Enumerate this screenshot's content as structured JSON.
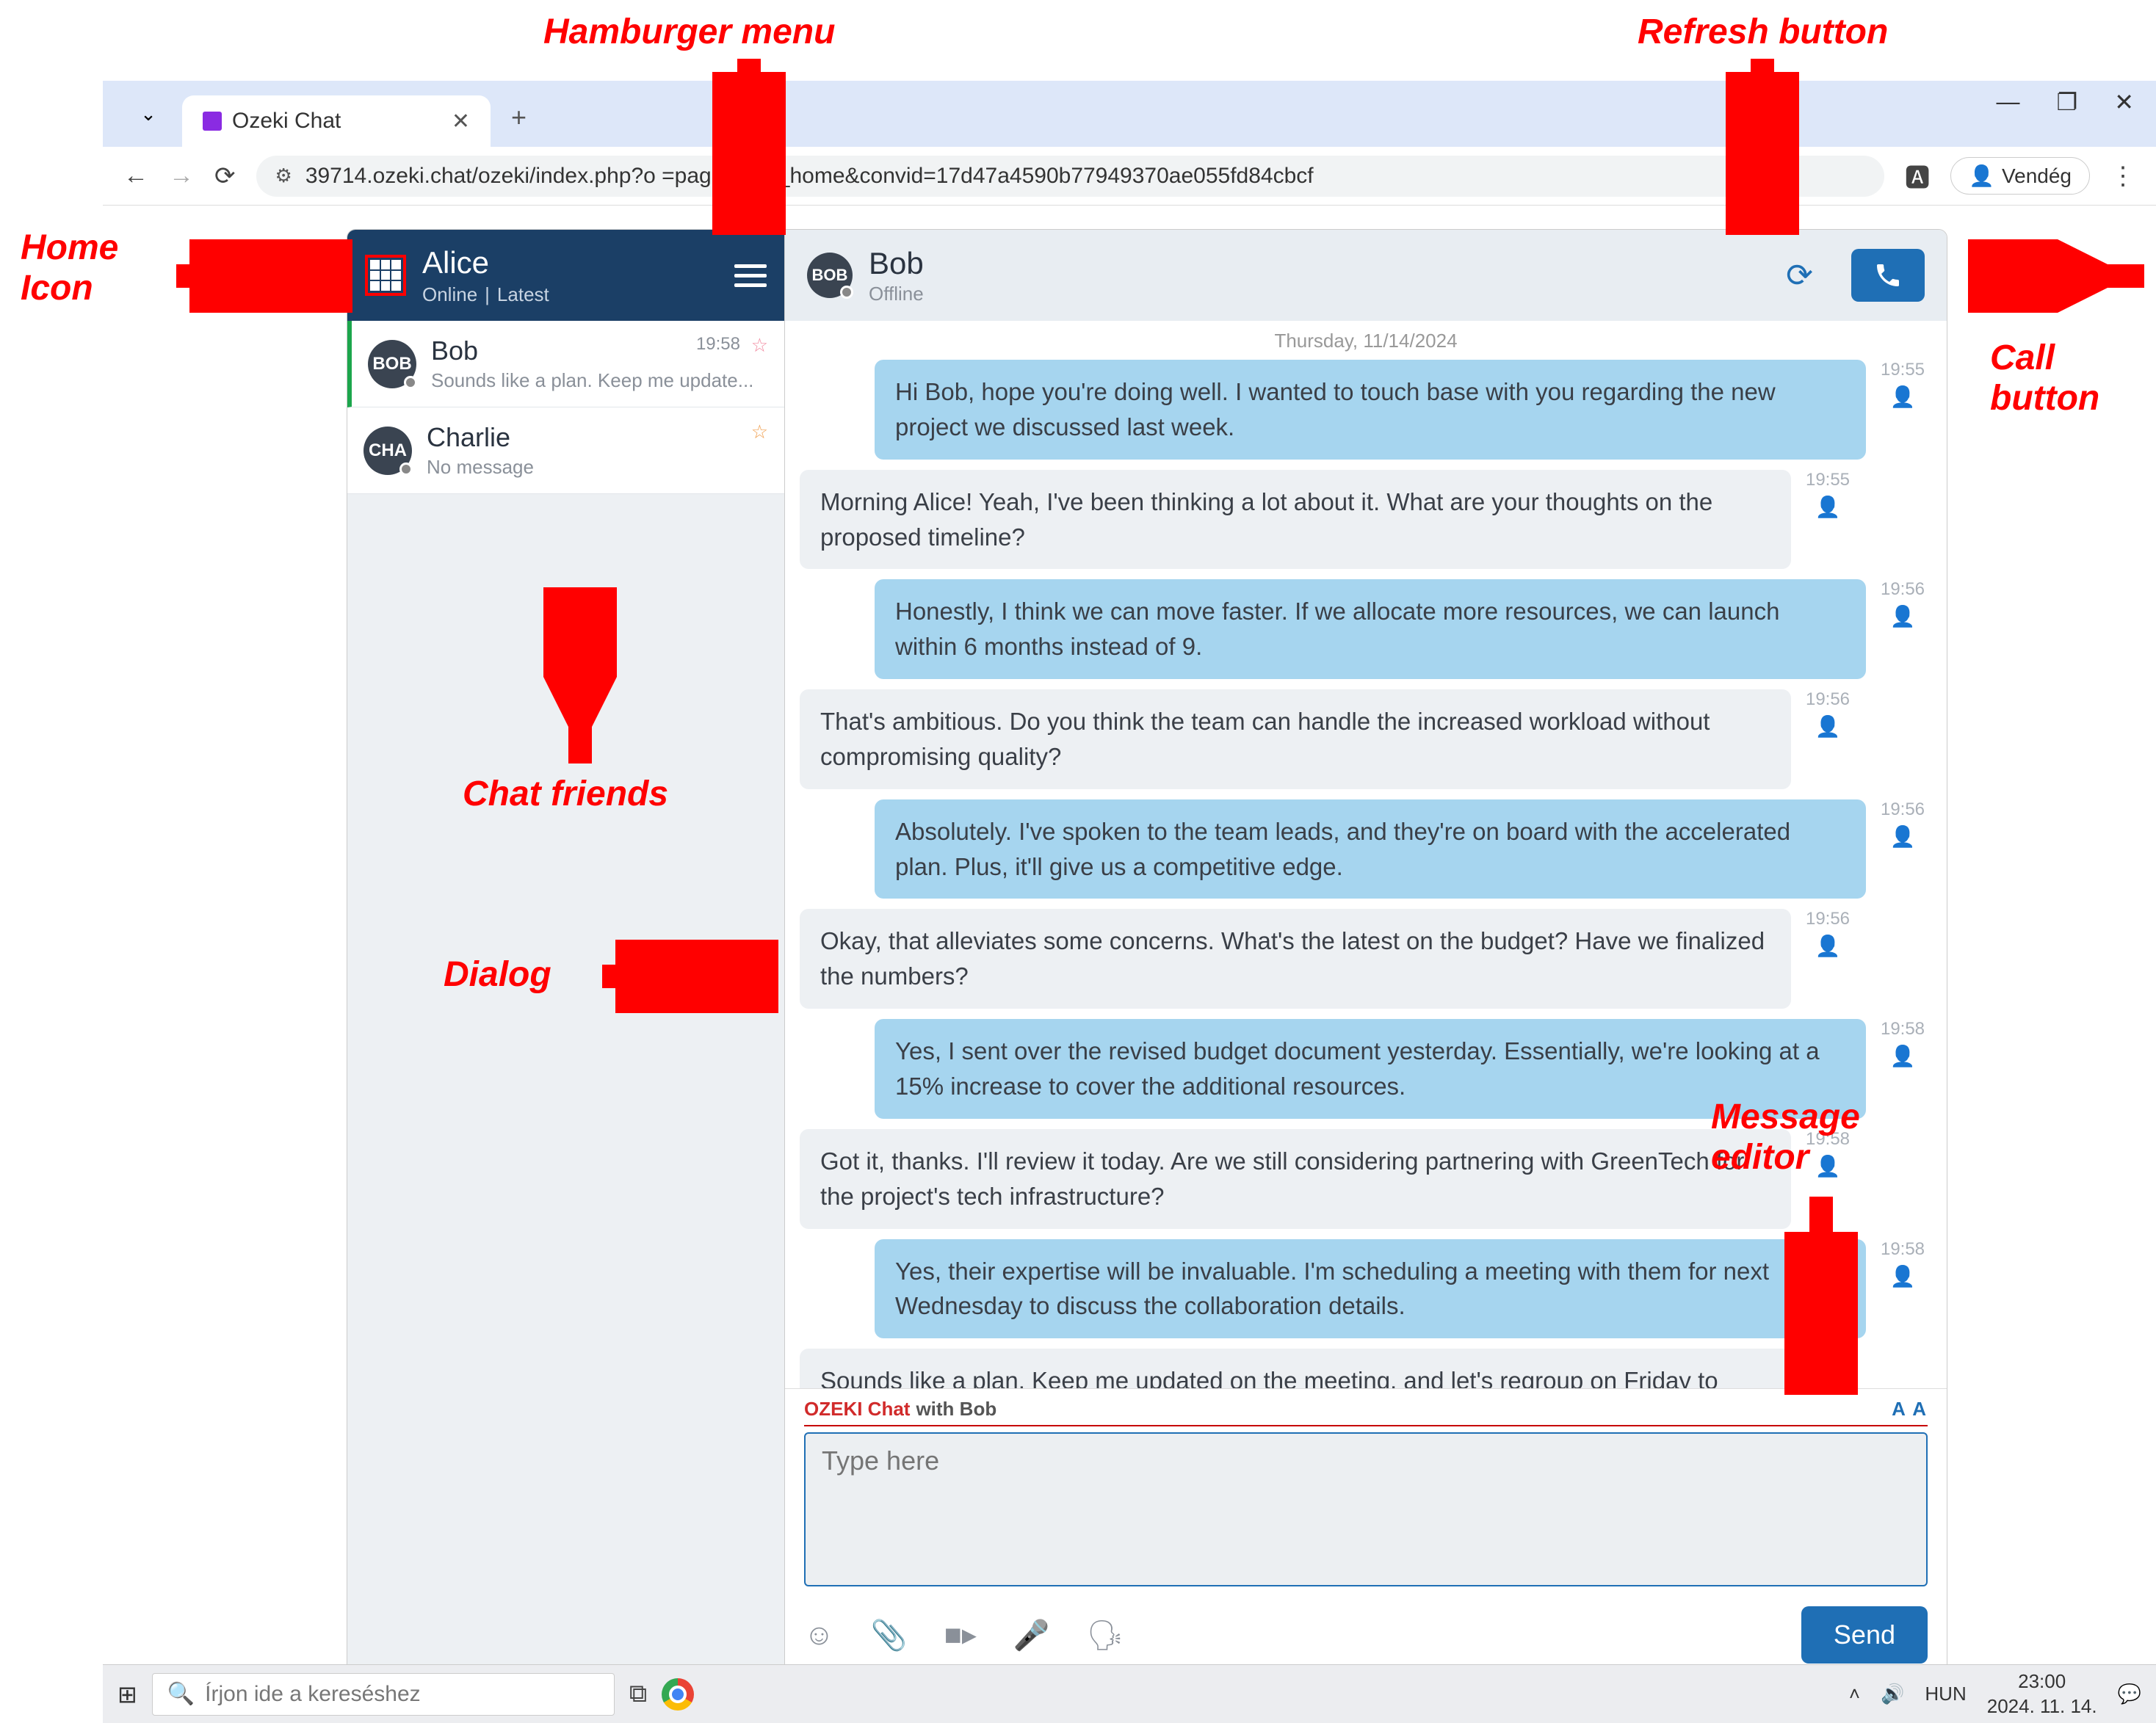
{
  "annotations": {
    "hamburger": "Hamburger menu",
    "refresh": "Refresh button",
    "home": "Home Icon",
    "call": "Call button",
    "friends": "Chat friends",
    "dialog": "Dialog",
    "editor": "Message editor"
  },
  "browser": {
    "tab_title": "Ozeki Chat",
    "url": "39714.ozeki.chat/ozeki/index.php?o      =page_chat_home&convid=17d47a4590b77949370ae055fd84cbcf",
    "guest": "Vendég"
  },
  "sidebar": {
    "user": {
      "name": "Alice",
      "status_online": "Online",
      "status_latest": "Latest"
    },
    "contacts": [
      {
        "avatar": "BOB",
        "name": "Bob",
        "preview": "Sounds like a plan. Keep me update...",
        "time": "19:58",
        "star": "pink",
        "active": true
      },
      {
        "avatar": "CHA",
        "name": "Charlie",
        "preview": "No message",
        "time": "",
        "star": "orange",
        "active": false
      }
    ]
  },
  "chat": {
    "header": {
      "avatar": "BOB",
      "name": "Bob",
      "status": "Offline"
    },
    "date": "Thursday, 11/14/2024",
    "messages": [
      {
        "side": "sent",
        "time": "19:55",
        "text": "Hi Bob, hope you're doing well. I wanted to touch base with you regarding the new project we discussed last week."
      },
      {
        "side": "recv",
        "time": "19:55",
        "text": "Morning Alice! Yeah, I've been thinking a lot about it. What are your thoughts on the proposed timeline?"
      },
      {
        "side": "sent",
        "time": "19:56",
        "text": "Honestly, I think we can move faster. If we allocate more resources, we can launch within 6 months instead of 9."
      },
      {
        "side": "recv",
        "time": "19:56",
        "text": "That's ambitious. Do you think the team can handle the increased workload without compromising quality?"
      },
      {
        "side": "sent",
        "time": "19:56",
        "text": "Absolutely. I've spoken to the team leads, and they're on board with the accelerated plan. Plus, it'll give us a competitive edge."
      },
      {
        "side": "recv",
        "time": "19:56",
        "text": "Okay, that alleviates some concerns. What's the latest on the budget? Have we finalized the numbers?"
      },
      {
        "side": "sent",
        "time": "19:58",
        "text": "Yes, I sent over the revised budget document yesterday. Essentially, we're looking at a 15% increase to cover the additional resources."
      },
      {
        "side": "recv",
        "time": "19:58",
        "text": "Got it, thanks. I'll review it today. Are we still considering partnering with GreenTech for the project's tech infrastructure?"
      },
      {
        "side": "sent",
        "time": "19:58",
        "text": "Yes, their expertise will be invaluable. I'm scheduling a meeting with them for next Wednesday to discuss the collaboration details."
      },
      {
        "side": "recv",
        "time": "19:58",
        "text": "Sounds like a plan. Keep me updated on the meeting, and let's regroup on Friday to finalize our approach before moving forward."
      }
    ],
    "editor": {
      "brand": "OZEKI Chat",
      "with": "with Bob",
      "placeholder": "Type here",
      "font_sizes": "A A",
      "send": "Send"
    }
  },
  "taskbar": {
    "search_placeholder": "Írjon ide a kereséshez",
    "lang": "HUN",
    "time": "23:00",
    "date": "2024. 11. 14."
  }
}
